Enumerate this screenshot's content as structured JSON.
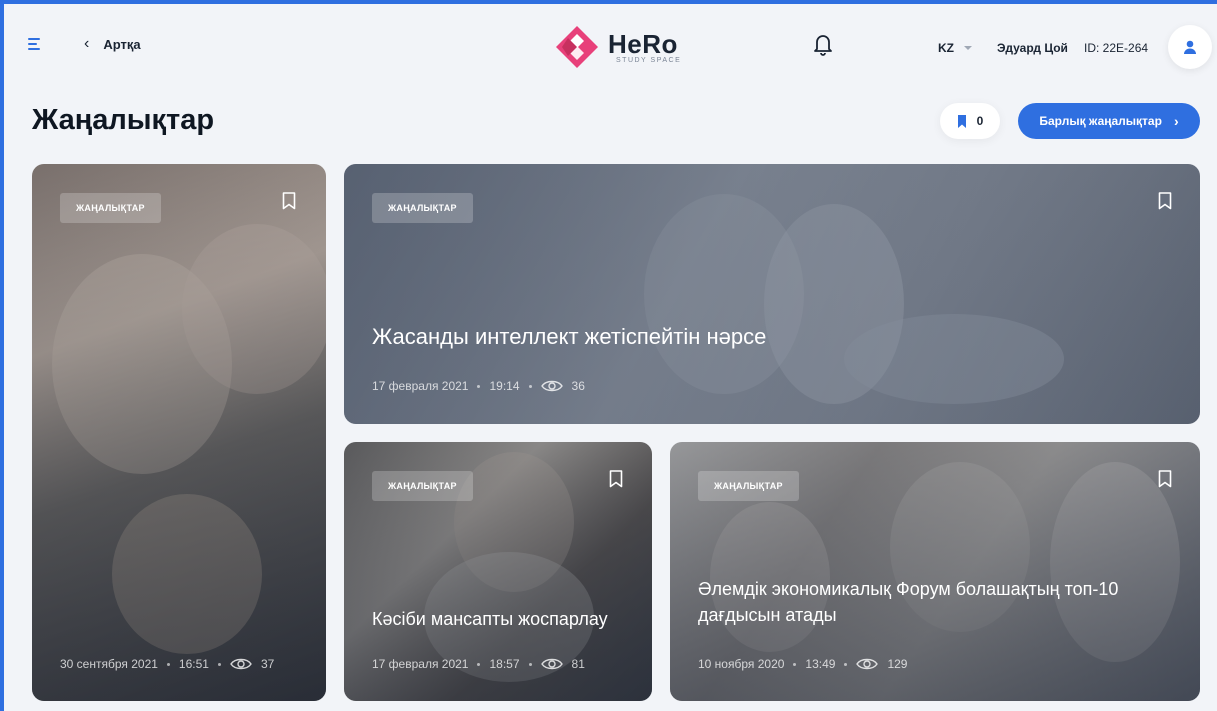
{
  "header": {
    "back_label": "Артқа",
    "logo_name": "HeRo",
    "logo_sub": "STUDY SPACE",
    "lang": "KZ",
    "user_name": "Эдуард Цой",
    "user_id": "ID: 22E-264"
  },
  "page": {
    "title": "Жаңалықтар",
    "bookmark_count": "0",
    "all_news_label": "Барлық жаңалықтар"
  },
  "colors": {
    "accent": "#2f6fe0",
    "logo_pink": "#e8407a",
    "text_dark": "#1a2433"
  },
  "cards": [
    {
      "tag": "ЖАҢАЛЫҚТАР",
      "title": "",
      "date": "30 сентября 2021",
      "time": "16:51",
      "views": "37"
    },
    {
      "tag": "ЖАҢАЛЫҚТАР",
      "title": "Жасанды интеллект жетіспейтін нәрсе",
      "date": "17 февраля 2021",
      "time": "19:14",
      "views": "36"
    },
    {
      "tag": "ЖАҢАЛЫҚТАР",
      "title": "Кәсіби мансапты жоспарлау",
      "date": "17 февраля 2021",
      "time": "18:57",
      "views": "81"
    },
    {
      "tag": "ЖАҢАЛЫҚТАР",
      "title": "Әлемдік экономикалық Форум болашақтың топ-10 дағдысын атады",
      "date": "10 ноября 2020",
      "time": "13:49",
      "views": "129"
    }
  ]
}
